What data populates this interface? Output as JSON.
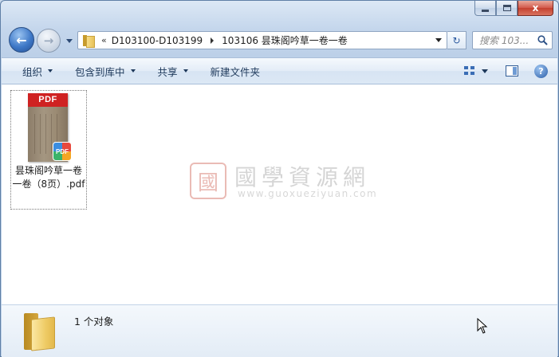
{
  "window": {
    "min_glyph": "",
    "close_glyph": "x"
  },
  "nav": {
    "back_glyph": "←",
    "forward_glyph": "→",
    "breadcrumb_overflow": "«",
    "breadcrumbs": [
      "D103100-D103199",
      "103106 昙珠阁吟草一卷一卷"
    ],
    "refresh_glyph": "↻",
    "search_placeholder": "搜索 103..."
  },
  "toolbar": {
    "organize": "组织",
    "include_in_library": "包含到库中",
    "share": "共享",
    "new_folder": "新建文件夹",
    "help_glyph": "?"
  },
  "file": {
    "name": "昙珠阁吟草一卷一卷（8页）.pdf",
    "thumb_band": "PDF",
    "badge": "PDF"
  },
  "watermark": {
    "seal": "國",
    "chinese": "國學資源網",
    "english": "www.guoxueziyuan.com"
  },
  "details": {
    "object_count": "1 个对象"
  },
  "colors": {
    "accent": "#1e395b",
    "frame": "#bcd0e8",
    "close_button": "#c4402f",
    "pdf_red": "#cf2222"
  },
  "icons": [
    "back-arrow-icon",
    "forward-arrow-icon",
    "folder-icon",
    "refresh-icon",
    "search-icon",
    "views-icon",
    "preview-pane-icon",
    "help-icon",
    "pdf-icon",
    "cursor-icon"
  ]
}
